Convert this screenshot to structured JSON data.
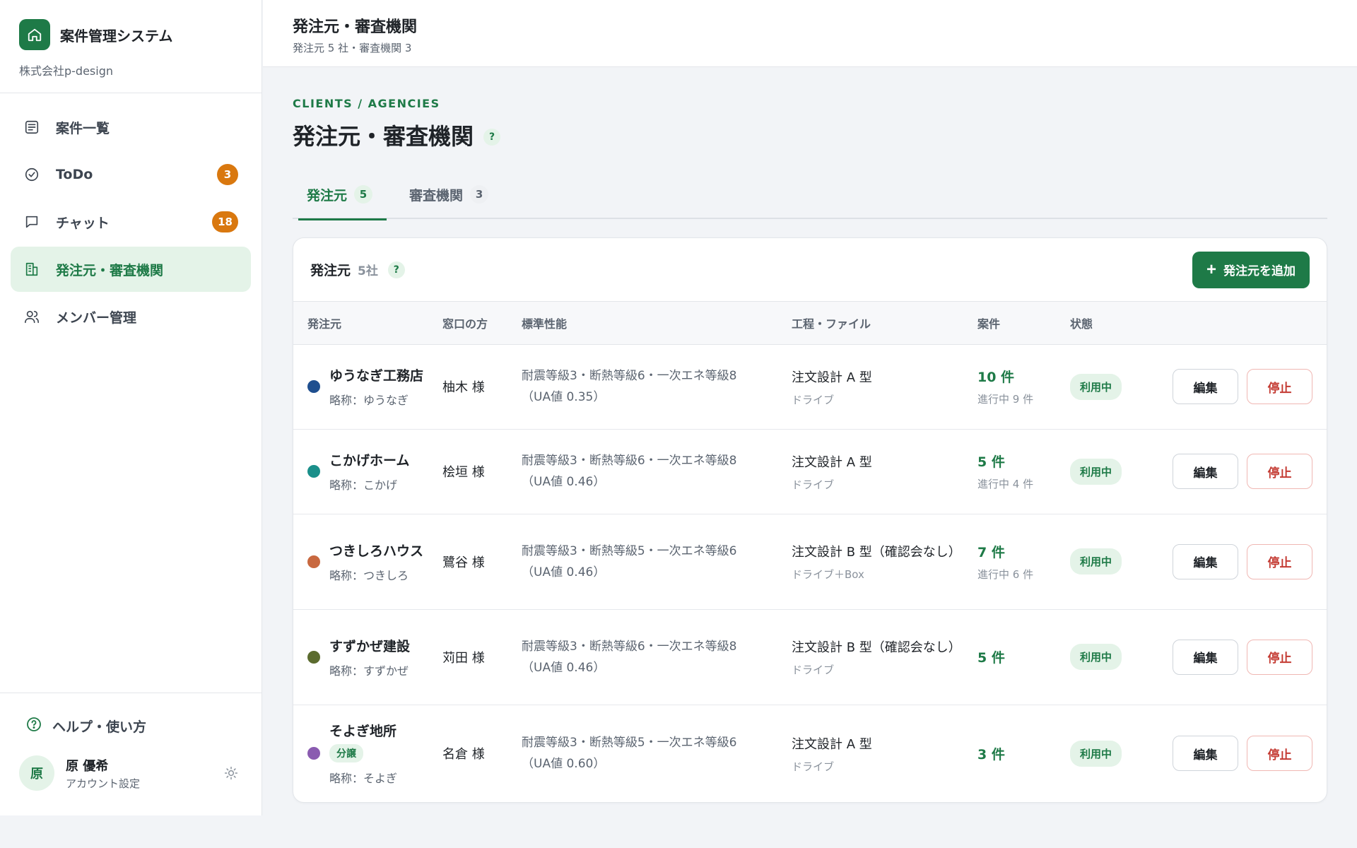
{
  "brand": {
    "title": "案件管理システム",
    "company": "株式会社p-design",
    "logo_icon": "home-icon",
    "color": "#1e7a47"
  },
  "sidebar": {
    "items": [
      {
        "label": "案件一覧",
        "icon": "list-icon",
        "badge": ""
      },
      {
        "label": "ToDo",
        "icon": "check-circle-icon",
        "badge": "3"
      },
      {
        "label": "チャット",
        "icon": "chat-icon",
        "badge": "18"
      },
      {
        "label": "発注元・審査機関",
        "icon": "building-icon",
        "badge": "",
        "active": true
      },
      {
        "label": "メンバー管理",
        "icon": "users-icon",
        "badge": ""
      }
    ],
    "help_label": "ヘルプ・使い方",
    "user": {
      "avatar": "原",
      "name": "原 優希",
      "sub": "アカウント設定"
    }
  },
  "header": {
    "title": "発注元・審査機関",
    "subtitle": "発注元 5 社・審査機関 3"
  },
  "page": {
    "eyebrow": "CLIENTS / AGENCIES",
    "title": "発注元・審査機関",
    "help": "?"
  },
  "tabs": [
    {
      "label": "発注元",
      "count": "5",
      "active": true
    },
    {
      "label": "審査機関",
      "count": "3",
      "active": false
    }
  ],
  "card": {
    "title": "発注元",
    "count": "5社",
    "help": "?",
    "add_button": "発注元を追加",
    "columns": [
      "発注元",
      "窓口の方",
      "標準性能",
      "工程・ファイル",
      "案件",
      "状態",
      ""
    ],
    "rows": [
      {
        "name": "ゆうなぎ工務店",
        "alias": "略称：ゆうなぎ",
        "tag": "",
        "color": "#1f4f8f",
        "contact": "柚木 様",
        "perf_line1": "耐震等級3・断熱等級6・一次エネ等級8",
        "perf_line2": "（UA値 0.35）",
        "process": "注文設計 A 型",
        "storage": "ドライブ",
        "cases": "10 件",
        "cases_sub": "進行中 9 件",
        "status": "利用中"
      },
      {
        "name": "こかげホーム",
        "alias": "略称：こかげ",
        "tag": "",
        "color": "#1a8f8a",
        "contact": "桧垣 様",
        "perf_line1": "耐震等級3・断熱等級6・一次エネ等級8",
        "perf_line2": "（UA値 0.46）",
        "process": "注文設計 A 型",
        "storage": "ドライブ",
        "cases": "5 件",
        "cases_sub": "進行中 4 件",
        "status": "利用中"
      },
      {
        "name": "つきしろハウス",
        "alias": "略称：つきしろ",
        "tag": "",
        "color": "#c8683f",
        "contact": "鷺谷 様",
        "perf_line1": "耐震等級3・断熱等級5・一次エネ等級6",
        "perf_line2": "（UA値 0.46）",
        "process": "注文設計 B 型（確認会なし）",
        "storage": "ドライブ＋Box",
        "cases": "7 件",
        "cases_sub": "進行中 6 件",
        "status": "利用中"
      },
      {
        "name": "すずかぜ建設",
        "alias": "略称：すずかぜ",
        "tag": "",
        "color": "#5b6b2e",
        "contact": "苅田 様",
        "perf_line1": "耐震等級3・断熱等級6・一次エネ等級8",
        "perf_line2": "（UA値 0.46）",
        "process": "注文設計 B 型（確認会なし）",
        "storage": "ドライブ",
        "cases": "5 件",
        "cases_sub": "",
        "status": "利用中"
      },
      {
        "name": "そよぎ地所",
        "alias": "略称：そよぎ",
        "tag": "分譲",
        "color": "#8a5bb0",
        "contact": "名倉 様",
        "perf_line1": "耐震等級3・断熱等級5・一次エネ等級6",
        "perf_line2": "（UA値 0.60）",
        "process": "注文設計 A 型",
        "storage": "ドライブ",
        "cases": "3 件",
        "cases_sub": "",
        "status": "利用中"
      }
    ],
    "edit_label": "編集",
    "stop_label": "停止"
  }
}
